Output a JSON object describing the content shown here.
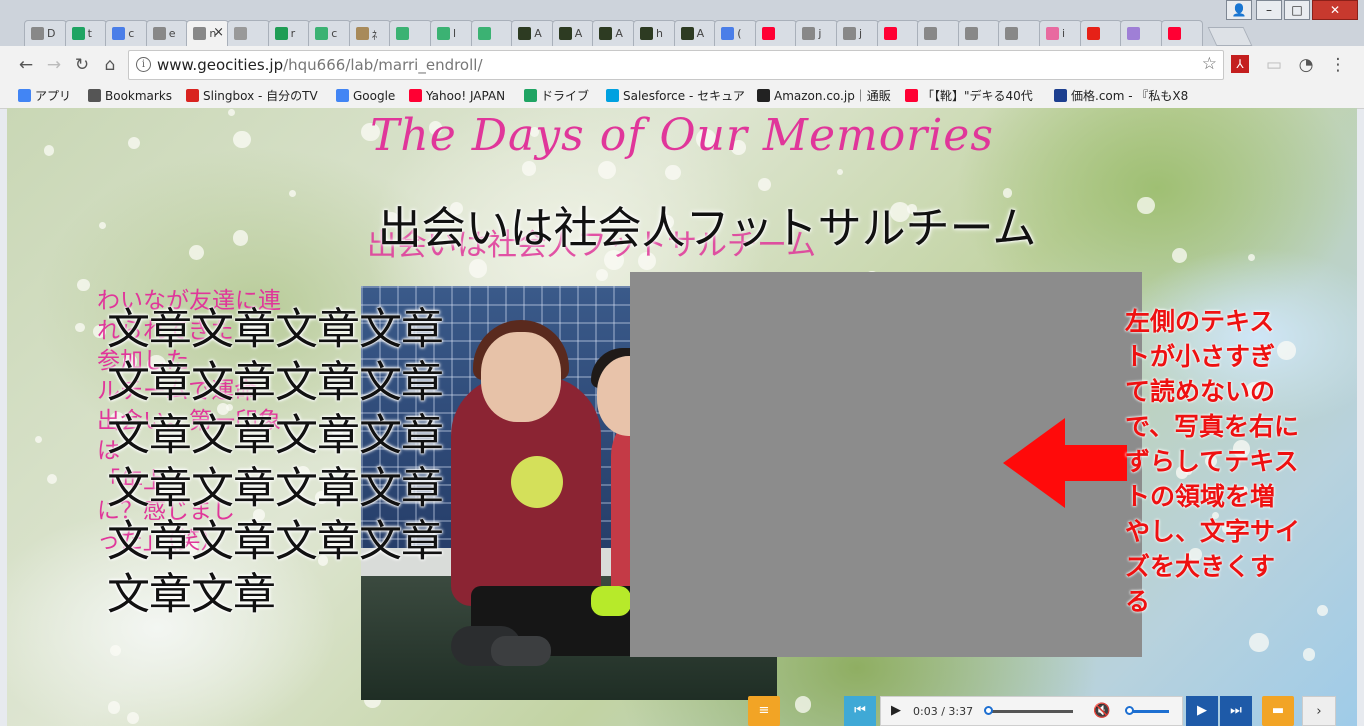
{
  "browser": {
    "tabs": [
      {
        "label": "D",
        "fav": "page-icon",
        "color": "#888888"
      },
      {
        "label": "t",
        "fav": "drive-icon",
        "color": "#1fa463"
      },
      {
        "label": "c",
        "fav": "docs-icon",
        "color": "#4a7ee8"
      },
      {
        "label": "e",
        "fav": "page-icon",
        "color": "#888888"
      },
      {
        "label": "n",
        "fav": "page-icon",
        "color": "#888888"
      },
      {
        "label": "",
        "fav": "wikipedia-icon",
        "color": "#999999"
      },
      {
        "label": "r",
        "fav": "sheets-icon",
        "color": "#1f9d55"
      },
      {
        "label": "c",
        "fav": "green-circle-icon",
        "color": "#3bb273"
      },
      {
        "label": "ﾈ",
        "fav": "wreath-icon",
        "color": "#a88a5a"
      },
      {
        "label": "",
        "fav": "green-circle-icon",
        "color": "#3bb273"
      },
      {
        "label": "l",
        "fav": "green-circle-icon",
        "color": "#3bb273"
      },
      {
        "label": "",
        "fav": "green-circle-icon",
        "color": "#3bb273"
      },
      {
        "label": "A",
        "fav": "dark-app-icon",
        "color": "#2d3b22"
      },
      {
        "label": "A",
        "fav": "dark-app-icon",
        "color": "#2d3b22"
      },
      {
        "label": "A",
        "fav": "dark-app-icon",
        "color": "#2d3b22"
      },
      {
        "label": "h",
        "fav": "dark-app-icon",
        "color": "#2d3b22"
      },
      {
        "label": "A",
        "fav": "dark-app-icon",
        "color": "#2d3b22"
      },
      {
        "label": "(",
        "fav": "translate-icon",
        "color": "#4a7ee8"
      },
      {
        "label": "",
        "fav": "yahoo-icon",
        "color": "#ff0033"
      },
      {
        "label": "j",
        "fav": "page-icon",
        "color": "#888888"
      },
      {
        "label": "j",
        "fav": "page-icon",
        "color": "#888888"
      },
      {
        "label": "",
        "fav": "yahoo-icon",
        "color": "#ff0033"
      },
      {
        "label": "",
        "fav": "page-icon",
        "color": "#888888"
      },
      {
        "label": "",
        "fav": "page-icon",
        "color": "#888888"
      },
      {
        "label": "",
        "fav": "page-icon",
        "color": "#888888"
      },
      {
        "label": "i",
        "fav": "pink-face-icon",
        "color": "#e86aa0"
      },
      {
        "label": "",
        "fav": "youtube-icon",
        "color": "#e62117"
      },
      {
        "label": "",
        "fav": "flower-icon",
        "color": "#9f7fd6"
      },
      {
        "label": "",
        "fav": "yahoo-icon",
        "color": "#ff0033"
      }
    ],
    "url_domain": "www.geocities.jp",
    "url_path": "/hqu666/lab/marri_endroll/",
    "bookmarks": [
      {
        "label": "アプリ",
        "icon": "apps-grid-icon",
        "color": "#4285f4"
      },
      {
        "label": "Bookmarks",
        "icon": "star-icon",
        "color": "#555555"
      },
      {
        "label": "Slingbox - 自分のTV",
        "icon": "slingbox-icon",
        "color": "#d9231f"
      },
      {
        "label": "Google",
        "icon": "google-icon",
        "color": "#4285f4"
      },
      {
        "label": "Yahoo! JAPAN",
        "icon": "yahoo-icon",
        "color": "#ff0033"
      },
      {
        "label": "ドライブ",
        "icon": "drive-icon",
        "color": "#1fa463"
      },
      {
        "label": "Salesforce - セキュア",
        "icon": "salesforce-icon",
        "color": "#00a1e0"
      },
      {
        "label": "Amazon.co.jp｜通販",
        "icon": "amazon-icon",
        "color": "#222222"
      },
      {
        "label": "「【靴】\"デキる40代",
        "icon": "yahoo-icon",
        "color": "#ff0033"
      },
      {
        "label": "価格.com - 『私もX8",
        "icon": "kakaku-icon",
        "color": "#1d3f8f"
      }
    ]
  },
  "page": {
    "script_title": "The Days of Our Memories",
    "heading": "出会いは社会人フットサルチーム",
    "pink_lines": [
      "わいなが友達に連",
      "れられてきた",
      "参加した",
      "ルチームで運命",
      "出会い。第一印象",
      "は",
      "「年上",
      "に？感じまし",
      "った」（笑）"
    ],
    "big_lines": [
      "文章文章文章文章",
      "文章文章文章文章",
      "文章文章文章文章",
      "文章文章文章文章",
      "文章文章文章文章",
      "文章文章"
    ],
    "annotation_lines": [
      "左側のテキス",
      "トが小さすぎ",
      "て読めないの",
      "で、写真を右に",
      "ずらしてテキス",
      "トの領域を増",
      "やし、文字サイ",
      "ズを大きくす",
      "る"
    ]
  },
  "player": {
    "time_current": "0:03",
    "time_separator": "/",
    "time_total": "3:37",
    "progress": 0.014
  }
}
